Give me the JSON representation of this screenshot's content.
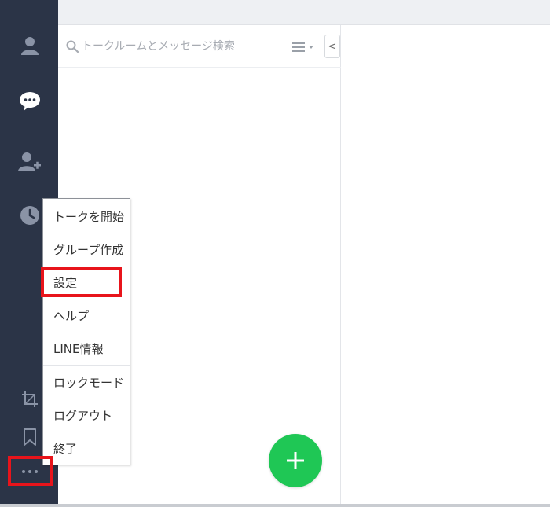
{
  "search": {
    "placeholder": "トークルームとメッセージ検索"
  },
  "list_panel": {
    "collapse_glyph": "<",
    "menu_glyph": "☰ ▾"
  },
  "context_menu": {
    "items": [
      {
        "label": "トークを開始"
      },
      {
        "label": "グループ作成"
      },
      {
        "label": "設定"
      },
      {
        "label": "ヘルプ"
      },
      {
        "label": "LINE情報"
      },
      {
        "label": "ロックモード"
      },
      {
        "label": "ログアウト"
      },
      {
        "label": "終了"
      }
    ]
  },
  "sidebar": {
    "icons": [
      "person-icon",
      "chat-bubble-icon",
      "add-friend-icon",
      "clock-icon",
      "crop-icon",
      "bookmark-icon",
      "more-icon"
    ]
  },
  "fab": {
    "glyph": "+"
  },
  "colors": {
    "sidebar_bg": "#2b3447",
    "fab_green": "#1fc755",
    "highlight_red": "#e8141b",
    "icon_gray": "#8a93a6"
  }
}
